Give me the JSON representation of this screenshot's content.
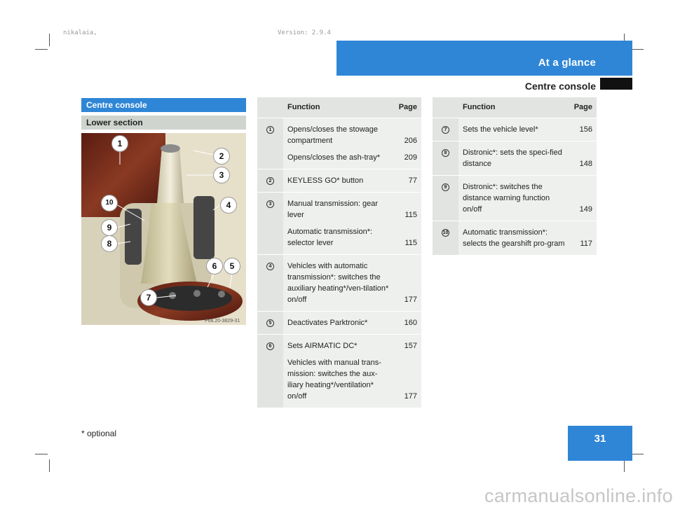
{
  "meta": {
    "left": "nikalaia,",
    "right": "Version: 2.9.4"
  },
  "header": {
    "title": "At a glance",
    "subtitle": "Centre console"
  },
  "section": {
    "title": "Centre console",
    "subtitle": "Lower section"
  },
  "photo": {
    "code": "P68.20-3829-31",
    "callouts": [
      "1",
      "2",
      "3",
      "4",
      "5",
      "6",
      "7",
      "8",
      "9",
      "10"
    ]
  },
  "table_left": {
    "headers": {
      "function": "Function",
      "page": "Page"
    },
    "rows": [
      {
        "no": "1",
        "entries": [
          {
            "text": "Opens/closes the stowage compartment",
            "page": "206"
          },
          {
            "text": "Opens/closes the ash-tray*",
            "page": "209"
          }
        ]
      },
      {
        "no": "2",
        "entries": [
          {
            "text": "KEYLESS GO* button",
            "page": "77"
          }
        ]
      },
      {
        "no": "3",
        "entries": [
          {
            "text": "Manual transmission: gear lever",
            "page": "115"
          },
          {
            "text": "Automatic transmission*: selector lever",
            "page": "115"
          }
        ]
      },
      {
        "no": "4",
        "entries": [
          {
            "text": "Vehicles with automatic transmission*: switches the auxiliary heating*/ven-tilation* on/off",
            "page": "177"
          }
        ]
      },
      {
        "no": "5",
        "entries": [
          {
            "text": "Deactivates Parktronic*",
            "page": "160"
          }
        ]
      },
      {
        "no": "6",
        "entries": [
          {
            "text": "Sets AIRMATIC DC*",
            "page": "157"
          },
          {
            "text": "Vehicles with manual trans-mission: switches the aux-iliary heating*/ventilation* on/off",
            "page": "177"
          }
        ]
      }
    ]
  },
  "table_right": {
    "headers": {
      "function": "Function",
      "page": "Page"
    },
    "rows": [
      {
        "no": "7",
        "entries": [
          {
            "text": "Sets the vehicle level*",
            "page": "156"
          }
        ]
      },
      {
        "no": "8",
        "entries": [
          {
            "text": "Distronic*: sets the speci-fied distance",
            "page": "148"
          }
        ]
      },
      {
        "no": "9",
        "entries": [
          {
            "text": "Distronic*: switches the distance warning function on/off",
            "page": "149"
          }
        ]
      },
      {
        "no": "10",
        "entries": [
          {
            "text": "Automatic transmission*: selects the gearshift pro-gram",
            "page": "117"
          }
        ]
      }
    ]
  },
  "footer": {
    "footnote": "* optional",
    "page_number": "31",
    "watermark": "carmanualsonline.info"
  }
}
